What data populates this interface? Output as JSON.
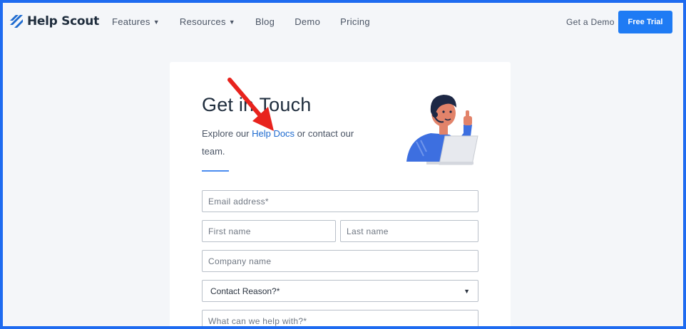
{
  "brand": {
    "name": "Help Scout",
    "color": "#1e6bd0"
  },
  "nav": {
    "items": [
      {
        "label": "Features",
        "has_dropdown": true
      },
      {
        "label": "Resources",
        "has_dropdown": true
      },
      {
        "label": "Blog",
        "has_dropdown": false
      },
      {
        "label": "Demo",
        "has_dropdown": false
      },
      {
        "label": "Pricing",
        "has_dropdown": false
      }
    ],
    "get_demo": "Get a Demo",
    "free_trial": "Free Trial"
  },
  "contact": {
    "title": "Get in Touch",
    "subtitle_prefix": "Explore our ",
    "subtitle_link": "Help Docs",
    "subtitle_suffix": " or contact our team."
  },
  "form": {
    "email_placeholder": "Email address*",
    "first_name_placeholder": "First name",
    "last_name_placeholder": "Last name",
    "company_placeholder": "Company name",
    "reason_selected": "Contact Reason?*",
    "help_placeholder": "What can we help with?*"
  },
  "colors": {
    "accent": "#1e7bf4",
    "frame": "#1e6bf0",
    "annotation_arrow": "#e8231d"
  }
}
